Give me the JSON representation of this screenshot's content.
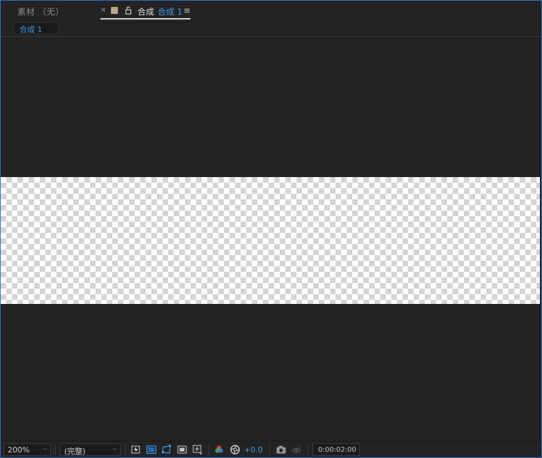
{
  "tabs": {
    "footage_label": "素材  （无）",
    "close_glyph": "×",
    "comp_prefix": "合成",
    "comp_name": "合成 1",
    "menu_glyph": "≡",
    "swatch_color": "#b8a486"
  },
  "breadcrumb": {
    "label": "合成 1"
  },
  "toolbar": {
    "zoom": "200%",
    "resolution": "(完整)",
    "exposure": "+0.0",
    "timecode": "0:00:02:00",
    "chevron": "⌵"
  },
  "icons": [
    "snapshot-fast-preview-icon",
    "transparency-grid-icon",
    "mask-path-icon",
    "region-of-interest-icon",
    "grid-guides-icon",
    "color-channel-icon",
    "reset-exposure-icon",
    "camera-snapshot-icon",
    "show-snapshot-icon"
  ],
  "colors": {
    "accent": "#3d9bf0",
    "panel": "#232323",
    "border_focus": "#2f6fd4"
  }
}
